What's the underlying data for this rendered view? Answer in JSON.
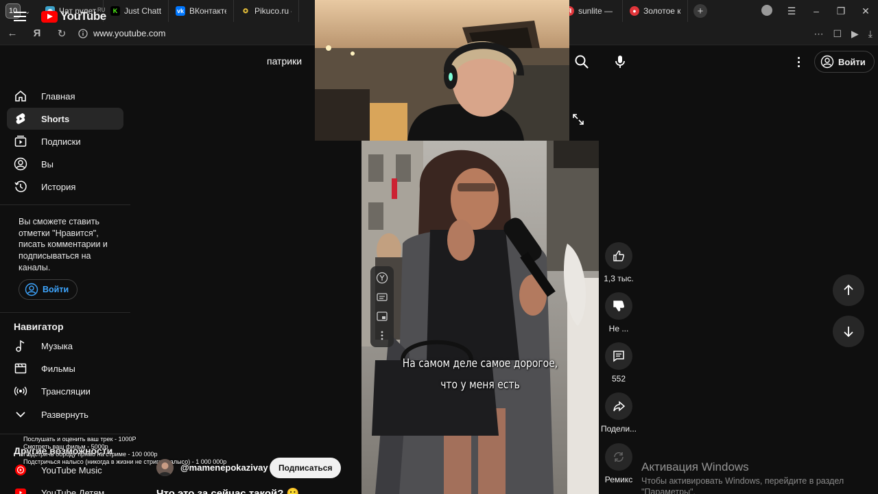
{
  "browser": {
    "tab_count": "10",
    "tabs": [
      {
        "title": "Чат рулетка",
        "color": "#3aa0c8"
      },
      {
        "title": "Just Chatting",
        "color": "#53fc18"
      },
      {
        "title": "ВКонтакте",
        "color": "#0077ff"
      },
      {
        "title": "Pikuco.ru —",
        "color": "#e8c13a"
      }
    ],
    "tabs_right": [
      {
        "title": "sunlite — Я",
        "color": "#e0353a"
      },
      {
        "title": "Золотое ко",
        "color": "#e0353a"
      }
    ],
    "url": "www.youtube.com"
  },
  "youtube": {
    "logo_text": "YouTube",
    "region": "RU",
    "search_query": "патрики",
    "signin_label": "Войти"
  },
  "sidebar": {
    "items": [
      {
        "label": "Главная",
        "icon": "home-icon"
      },
      {
        "label": "Shorts",
        "icon": "shorts-icon",
        "active": true
      },
      {
        "label": "Подписки",
        "icon": "subscriptions-icon"
      },
      {
        "label": "Вы",
        "icon": "you-icon"
      },
      {
        "label": "История",
        "icon": "history-icon"
      }
    ],
    "promo_text": "Вы сможете ставить отметки \"Нравится\", писать комментарии и подписываться на каналы.",
    "signin_label": "Войти",
    "navigator_title": "Навигатор",
    "navigator_items": [
      {
        "label": "Музыка",
        "icon": "music-icon"
      },
      {
        "label": "Фильмы",
        "icon": "movies-icon"
      },
      {
        "label": "Трансляции",
        "icon": "live-icon"
      },
      {
        "label": "Развернуть",
        "icon": "chevron-down-icon"
      }
    ],
    "more_title": "Другие возможности",
    "more_items": [
      {
        "label": "YouTube Music",
        "icon": "youtube-music-icon"
      },
      {
        "label": "YouTube Детям",
        "icon": "youtube-kids-icon"
      }
    ]
  },
  "stream_overlay": [
    "Послушать и оценить ваш трек - 1000Р",
    "Смотреть ваш фильм - 5000р",
    "Подстричь бороду прямо на стриме - 100 000р",
    "Подстричься налысо (никогда в жизни не стригся налысо) - 1 000 000р"
  ],
  "short": {
    "subtitle_line1": "На самом деле самое дорогое,",
    "subtitle_line2": "что у меня есть",
    "channel": "@mamenepokazivay",
    "subscribe_label": "Подписаться",
    "title": "Что это за сейчас такой? 😮",
    "actions": [
      {
        "icon": "like-icon",
        "label": "1,3 тыс."
      },
      {
        "icon": "dislike-icon",
        "label": "Не ..."
      },
      {
        "icon": "comment-icon",
        "label": "552"
      },
      {
        "icon": "share-icon",
        "label": "Подели..."
      },
      {
        "icon": "remix-icon",
        "label": "Ремикс"
      }
    ]
  },
  "windows_activation": {
    "title": "Активация Windows",
    "line1": "Чтобы активировать Windows, перейдите в раздел",
    "line2": "\"Параметры\"."
  }
}
